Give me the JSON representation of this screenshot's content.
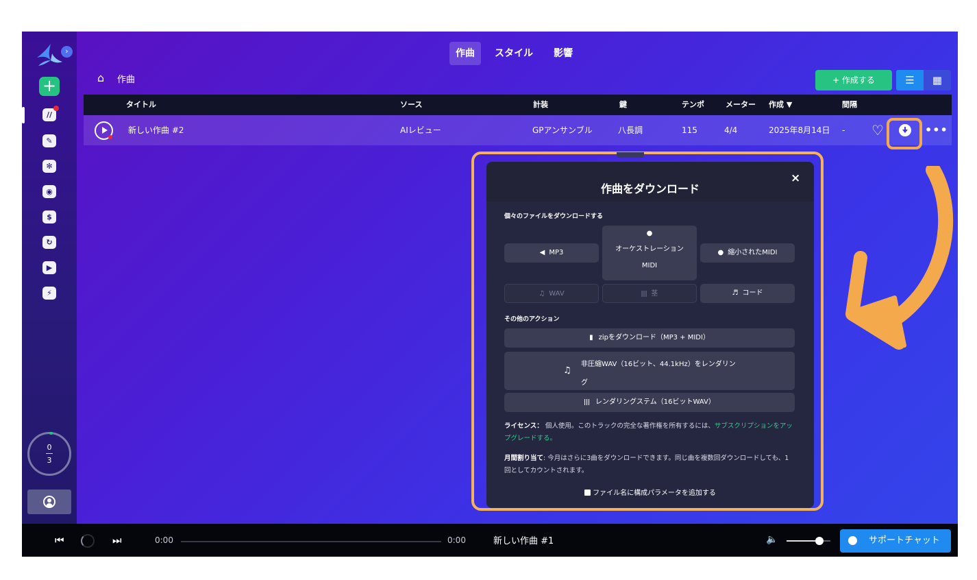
{
  "tabs": [
    {
      "label": "作曲"
    },
    {
      "label": "スタイル"
    },
    {
      "label": "影響"
    }
  ],
  "breadcrumb": {
    "label": "作曲"
  },
  "toolbar": {
    "create_label": "+ 作成する"
  },
  "table": {
    "headers": [
      "タイトル",
      "ソース",
      "計装",
      "鍵",
      "テンポ",
      "メーター",
      "作成 ▼",
      "間隔"
    ],
    "row": {
      "title": "新しい作曲 #2",
      "source": "AIレビュー",
      "instrument": "GPアンサンブル",
      "key": "八長調",
      "tempo": "115",
      "meter": "4/4",
      "created": "2025年8月14日",
      "duration": "-"
    }
  },
  "quota": {
    "used": "0",
    "total": "3"
  },
  "modal": {
    "title": "作曲をダウンロード",
    "close": "×",
    "individual_section": "個々のファイルをダウンロードする",
    "options": {
      "mp3": "MP3",
      "orch_midi_line1": "オーケストレーション",
      "orch_midi_line2": "MIDI",
      "reduced_midi": "縮小されたMIDI",
      "wav": "WAV",
      "stems": "茎",
      "chords": "コード"
    },
    "other_section": "その他のアクション",
    "actions": {
      "zip": "zipをダウンロード（MP3 + MIDI）",
      "render_wav_line1": "非圧縮WAV（16ビット、44.1kHz）をレンダリン",
      "render_wav_line2": "グ",
      "render_stems": "レンダリングステム（16ビットWAV）"
    },
    "license_label": "ライセンス：",
    "license_text": " 個人使用。このトラックの完全な著作権を所有するには、",
    "license_link": "サブスクリプションをアップグレードする。",
    "quota_label": "月間割り当て",
    "quota_text": ": 今月はさらに3曲をダウンロードできます。同じ曲を複数回ダウンロードしても、1回としてカウントされます。",
    "checkbox_label": "ファイル名に構成パラメータを追加する"
  },
  "player": {
    "current_time": "0:00",
    "total_time": "0:00",
    "now_playing": "新しい作曲 #1",
    "volume": 0.75,
    "support_label": "サポートチャット"
  },
  "colors": {
    "accent_green": "#27c383",
    "accent_blue": "#1f8bf0",
    "highlight_orange": "#f4a94c"
  }
}
